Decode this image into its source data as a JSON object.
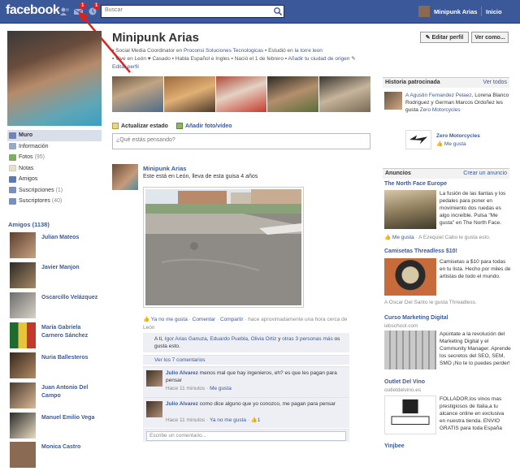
{
  "topbar": {
    "logo": "facebook",
    "badges": [
      "1",
      "1"
    ],
    "search_placeholder": "Buscar",
    "user_name": "Minipunk Arias",
    "home": "Inicio"
  },
  "left_nav": {
    "items": [
      {
        "label": "Muro",
        "count": ""
      },
      {
        "label": "Información",
        "count": ""
      },
      {
        "label": "Fotos",
        "count": "(95)"
      },
      {
        "label": "Notas",
        "count": ""
      },
      {
        "label": "Amigos",
        "count": ""
      },
      {
        "label": "Suscripciones",
        "count": "(1)"
      },
      {
        "label": "Suscriptores",
        "count": "(40)"
      }
    ],
    "friends_title": "Amigos (1138)",
    "friends": [
      "Julian Mateos",
      "Javier Manjon",
      "Oscarcillo Velázquez",
      "María Gabriela Carnero Sánchez",
      "Nuria Ballesteros",
      "Juan Antonio Del Campo",
      "Manuel Emilio Vega",
      "Monica Castro"
    ]
  },
  "profile": {
    "name": "Minipunk Arias",
    "info_line1_a": "Social Media Coordinator en ",
    "info_line1_link": "Proconsi Soluciones Tecnologicas",
    "info_line1_b": "Estudió en ",
    "info_line1_link2": "la torre leon",
    "info_line2": "Vive en León",
    "info_line2_b": "Casado",
    "info_line2_c": "Habla Español e Ingles",
    "info_line2_d": "Nació el 1 de febrero",
    "info_line2_link": "Añadir tu ciudad de origen",
    "edit_link": "Editar perfil",
    "edit_button": "Editar perfil",
    "more_button": "Ver como..."
  },
  "composer": {
    "tab_status": "Actualizar estado",
    "tab_photo": "Añadir foto/vídeo",
    "placeholder": "¿Qué estás pensando?"
  },
  "story": {
    "author": "Minipunk Arias",
    "text": "Este está en León, lleva de esta guisa 4 años",
    "unlike": "Ya no me gusta",
    "comment": "Comentar",
    "share": "Compartir",
    "time": "hace aproximadamente una hora cerca de León",
    "likes": {
      "prefix": "A ",
      "you": "ti",
      "sep1": ", ",
      "p1": "Igor Arias Ganuza",
      "sep2": ", ",
      "p2": "Eduardo Puebla",
      "sep3": ", ",
      "p3": "Olivia Ortiz",
      "mid": " y ",
      "others": "otras 3 personas más",
      "suffix": " os gusta esto."
    },
    "view_comments": "Ver los 7 comentarios",
    "comments": [
      {
        "author": "Julio Alvarez",
        "text": " menos mal que hay ingenieros, eh? es que les pagan para pensar",
        "time": "Hace 11 minutos",
        "action": "Me gusta",
        "count": ""
      },
      {
        "author": "Julio Alvarez",
        "text": " como dice alguno que yo conozco, me pagan para pensar",
        "time": "Hace 11 minutos",
        "action": "Ya no me gusta",
        "count": "1"
      }
    ],
    "comment_placeholder": "Escribe un comentario..."
  },
  "right": {
    "sponsored_title": "Historia patrocinada",
    "sponsored_link": "Ver todos",
    "sponsored_text_link": "A Agustin Fernandez Pelaez",
    "sponsored_text_rest": ", Lorena Blanco Rodriguez y German Marcos Ordoñez les gusta ",
    "sponsored_text_page": "Zero Motorcycles",
    "sponsored_page": "Zero Motorcycles",
    "sponsored_like": "Me gusta",
    "ads_title": "Anuncios",
    "ads_link": "Crear un anuncio",
    "ads": [
      {
        "title": "The North Face Europe",
        "desc": "La fusión de las llantas y los pedales para poner en movimiento dos ruedas es algo increíble. Pulsa \"Me gusta\" en The North Face.",
        "like": "Me gusta",
        "social": " · A Ezequiel Cabo le gusta esto."
      },
      {
        "title": "Camisetas Threadless $10!",
        "desc": "Camisetas a $10 para todas en tu lista. Hecho por miles de artistas de todo el mundo.",
        "like": "",
        "social": "A Oscar Del Santo le gusta Threadless."
      },
      {
        "title": "Curso Marketing Digital",
        "subtitle": "iebschool.com",
        "desc": "Apúntate a la revolución del Marketing Digital y el Community Manager. Aprende los secretos del SEO, SEM, SMO ¡No te lo puedes perder!",
        "like": "",
        "social": ""
      },
      {
        "title": "Outlet Del Vino",
        "subtitle": "outletdelvino.es",
        "desc": "FOLLADOR,los vinos mas prestigiosos de Italia,a tu alcance online en exclusiva en nuestra tienda. ENVIO GRATIS para toda España",
        "like": "",
        "social": ""
      },
      {
        "title": "Yinjbee",
        "desc": "",
        "like": "",
        "social": ""
      }
    ]
  },
  "colors": {
    "brand": "#3b5998",
    "badge": "#e02020",
    "annotation_arrow": "#e0201a"
  }
}
